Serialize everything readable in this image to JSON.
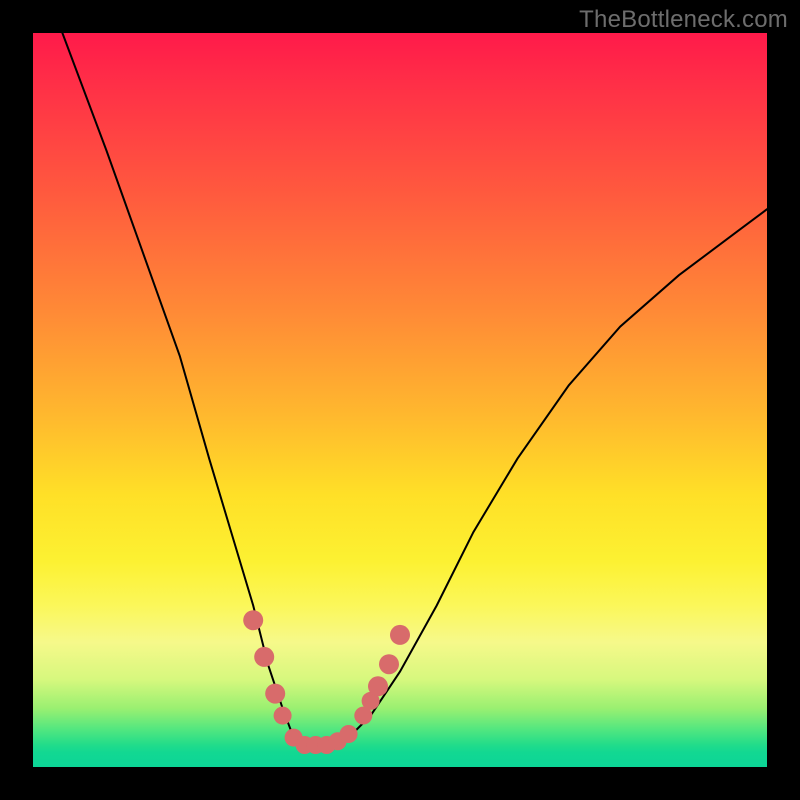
{
  "watermark": "TheBottleneck.com",
  "chart_data": {
    "type": "line",
    "title": "",
    "xlabel": "",
    "ylabel": "",
    "xlim": [
      0,
      100
    ],
    "ylim": [
      0,
      100
    ],
    "series": [
      {
        "name": "bottleneck-curve",
        "x": [
          4,
          10,
          15,
          20,
          24,
          27,
          30,
          32,
          34,
          35.5,
          37,
          40,
          43,
          46,
          50,
          55,
          60,
          66,
          73,
          80,
          88,
          96,
          100
        ],
        "y": [
          100,
          84,
          70,
          56,
          42,
          32,
          22,
          14,
          8,
          4,
          3,
          3,
          4,
          7,
          13,
          22,
          32,
          42,
          52,
          60,
          67,
          73,
          76
        ]
      }
    ],
    "markers": {
      "name": "highlight-points",
      "color": "#d86b6b",
      "points": [
        {
          "x": 30.0,
          "y": 20
        },
        {
          "x": 31.5,
          "y": 15
        },
        {
          "x": 33.0,
          "y": 10
        },
        {
          "x": 34.0,
          "y": 7
        },
        {
          "x": 35.5,
          "y": 4
        },
        {
          "x": 37.0,
          "y": 3
        },
        {
          "x": 38.5,
          "y": 3
        },
        {
          "x": 40.0,
          "y": 3
        },
        {
          "x": 41.5,
          "y": 3.5
        },
        {
          "x": 43.0,
          "y": 4.5
        },
        {
          "x": 45.0,
          "y": 7
        },
        {
          "x": 46.0,
          "y": 9
        },
        {
          "x": 47.0,
          "y": 11
        },
        {
          "x": 48.5,
          "y": 14
        },
        {
          "x": 50.0,
          "y": 18
        }
      ]
    }
  }
}
